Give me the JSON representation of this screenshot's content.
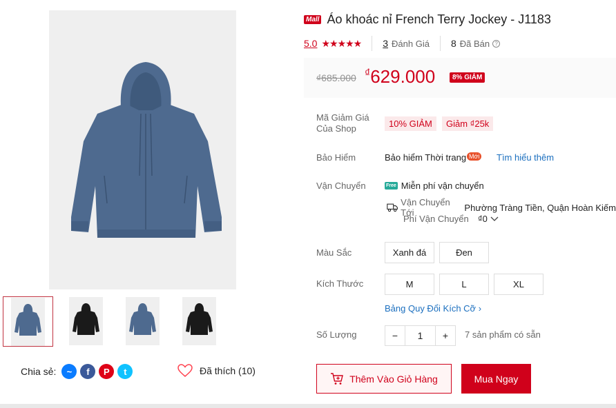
{
  "product": {
    "mall_badge": "Mall",
    "title": "Áo khoác nỉ French Terry Jockey - J1183",
    "rating": "5.0",
    "stars": "★★★★★",
    "review_count": "3",
    "review_label": "Đánh Giá",
    "sold_count": "8",
    "sold_label": "Đã Bán"
  },
  "price": {
    "old": "₫685.000",
    "currency": "₫",
    "new": "629.000",
    "discount": "8% GIẢM"
  },
  "details": {
    "voucher_label": "Mã Giảm Giá Của Shop",
    "vouchers": [
      "10% GIẢM",
      "Giảm ₫25k"
    ],
    "insurance_label": "Bảo Hiểm",
    "insurance_text": "Bảo hiểm Thời trang",
    "insurance_new": "Mới",
    "learn_more": "Tìm hiểu thêm",
    "shipping_label": "Vận Chuyển",
    "free_icon": "Free",
    "free_shipping": "Miễn phí vận chuyển",
    "ship_to_label": "Vận Chuyển Tới",
    "ship_to_address": "Phường Tràng Tiền, Quận Hoàn Kiếm",
    "ship_fee_label": "Phí Vận Chuyển",
    "ship_fee_value": "₫0"
  },
  "options": {
    "color_label": "Màu Sắc",
    "colors": [
      "Xanh đá",
      "Đen"
    ],
    "size_label": "Kích Thước",
    "sizes": [
      "M",
      "L",
      "XL"
    ],
    "size_chart": "Bảng Quy Đổi Kích Cỡ",
    "qty_label": "Số Lượng",
    "qty_minus": "−",
    "qty_value": "1",
    "qty_plus": "+",
    "stock": "7 sản phẩm có sẵn"
  },
  "actions": {
    "add_to_cart": "Thêm Vào Giỏ Hàng",
    "buy_now": "Mua Ngay"
  },
  "social": {
    "share_label": "Chia sẻ:",
    "like_label": "Đã thích (10)"
  },
  "colors": {
    "brand": "#d0011b",
    "link": "#1b6fbf",
    "jacket_blue": "#4e6a8f",
    "jacket_black": "#1a1a1a"
  }
}
